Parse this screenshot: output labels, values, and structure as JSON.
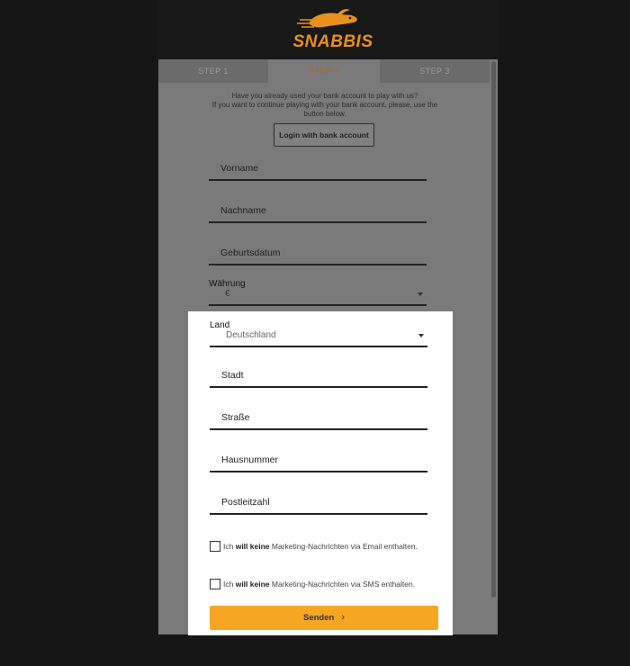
{
  "brand": {
    "logo_text": "SNABBIS",
    "accent_color": "#e8911c"
  },
  "tabs": [
    {
      "label": "STEP 1",
      "active": false
    },
    {
      "label": "STEP 2",
      "active": true
    },
    {
      "label": "STEP 3",
      "active": false
    }
  ],
  "intro": {
    "line1": "Have you already used your bank account to play with us?",
    "line2": "If you want to continue playing with your bank account, please, use the",
    "line3": "button below."
  },
  "login_button": "Login with bank account",
  "fields": {
    "first_name": "Vorname",
    "last_name": "Nachname",
    "birthdate": "Geburtsdatum",
    "currency_label": "Währung",
    "currency_value": "€",
    "country_label": "Land",
    "country_value": "Deutschland",
    "city": "Stadt",
    "street": "Straße",
    "house_number": "Hausnummer",
    "postal_code": "Postleitzahl"
  },
  "checks": {
    "email": {
      "prefix": "Ich ",
      "bold": "will keine",
      "suffix": " Marketing-Nachrichten via Email enthalten."
    },
    "sms": {
      "prefix": "Ich ",
      "bold": "will keine",
      "suffix": " Marketing-Nachrichten via SMS enthalten."
    }
  },
  "submit_button": "Senden",
  "colors": {
    "button": "#f6a623",
    "active_tab": "#b06a14"
  }
}
